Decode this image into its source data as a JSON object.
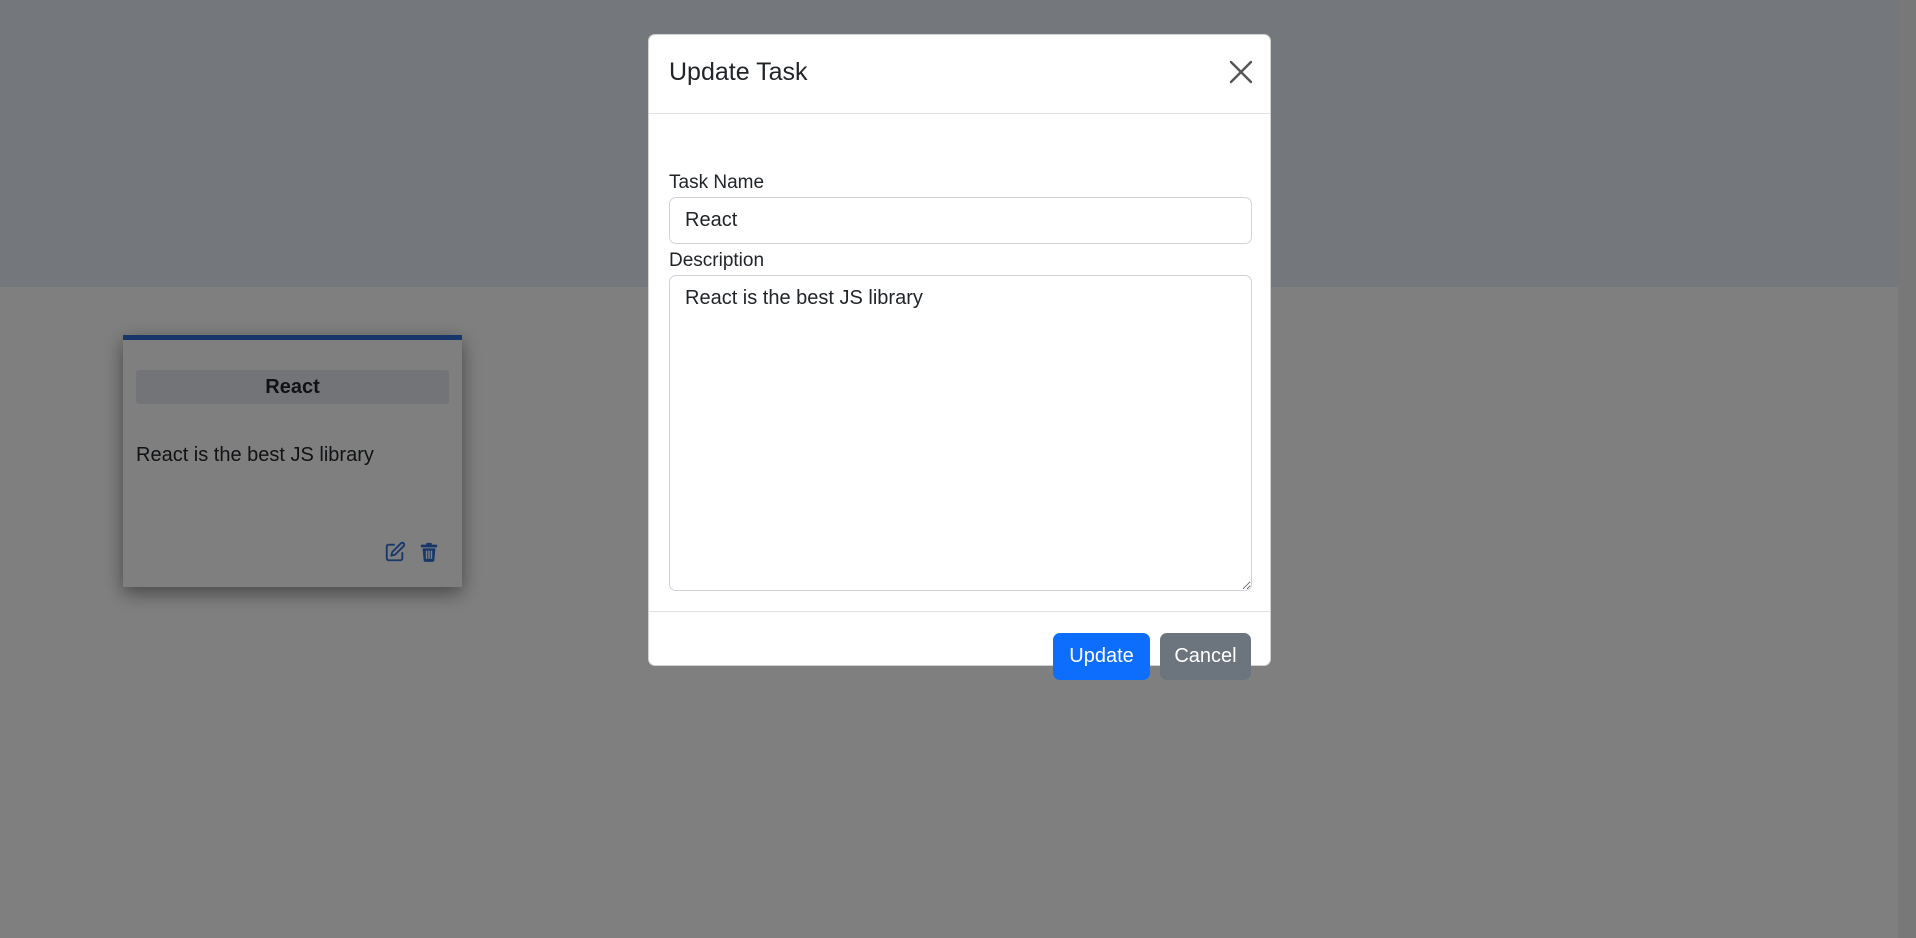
{
  "task_card": {
    "title": "React",
    "description": "React is the best JS library",
    "edit_icon": "edit-icon",
    "delete_icon": "trash-icon"
  },
  "modal": {
    "title": "Update Task",
    "close_icon": "close-icon",
    "task_name_label": "Task Name",
    "task_name_value": "React",
    "description_label": "Description",
    "description_value": "React is the best JS library",
    "update_label": "Update",
    "cancel_label": "Cancel"
  },
  "colors": {
    "primary": "#0d6efd",
    "secondary": "#6c757d",
    "card_accent": "#2e6fd6"
  }
}
